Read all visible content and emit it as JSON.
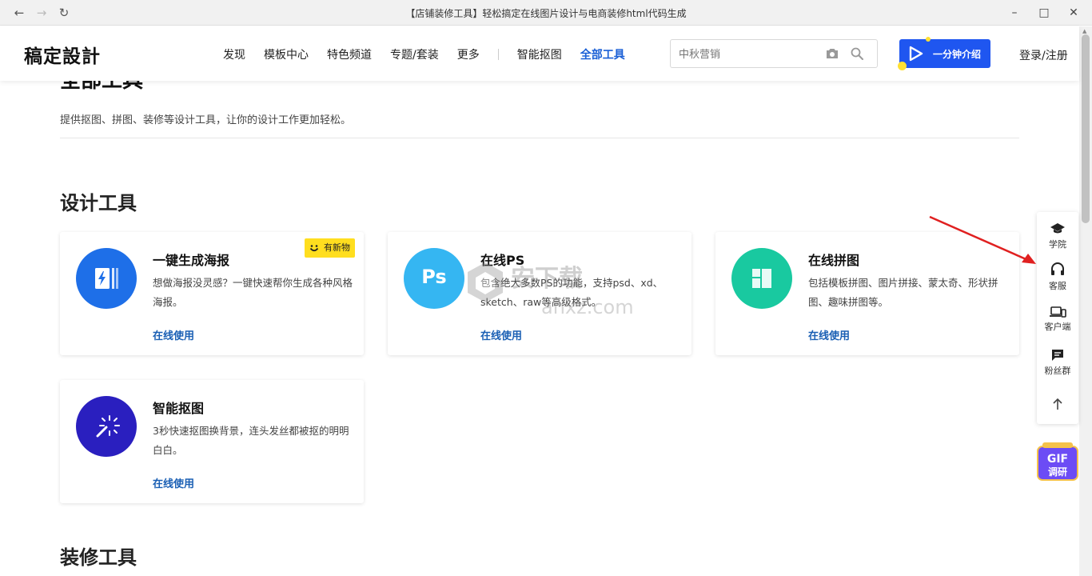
{
  "window": {
    "title": "【店铺装修工具】轻松搞定在线图片设计与电商装修html代码生成"
  },
  "header": {
    "logo": "稿定設計",
    "nav": [
      "发现",
      "模板中心",
      "特色频道",
      "专题/套装",
      "更多",
      "智能抠图",
      "全部工具"
    ],
    "active_nav": "全部工具",
    "search_placeholder": "中秋营销",
    "intro_button": "一分钟介绍",
    "login": "登录/注册"
  },
  "page": {
    "title": "全部工具",
    "description": "提供抠图、拼图、装修等设计工具，让你的设计工作更加轻松。"
  },
  "sections": {
    "design": {
      "title": "设计工具",
      "cards": [
        {
          "name": "一键生成海报",
          "desc": "想做海报没灵感？一键快速帮你生成各种风格海报。",
          "action": "在线使用",
          "badge": "有新物",
          "icon": "poster-icon",
          "color": "#1e6fe8"
        },
        {
          "name": "在线PS",
          "desc": "包含绝大多数PS的功能，支持psd、xd、sketch、raw等高级格式。",
          "action": "在线使用",
          "icon": "ps-icon",
          "icon_text": "Ps",
          "color": "#35b6f2"
        },
        {
          "name": "在线拼图",
          "desc": "包括模板拼图、图片拼接、蒙太奇、形状拼图、趣味拼图等。",
          "action": "在线使用",
          "icon": "collage-icon",
          "color": "#19c9a0"
        },
        {
          "name": "智能抠图",
          "desc": "3秒快速抠图换背景，连头发丝都被抠的明明白白。",
          "action": "在线使用",
          "icon": "magic-wand-icon",
          "color": "#2a1fbf"
        }
      ]
    },
    "decoration": {
      "title": "装修工具"
    }
  },
  "sidebar": {
    "items": [
      "学院",
      "客服",
      "客户端",
      "粉丝群"
    ],
    "gif_badge": "GIF调研"
  },
  "watermark": {
    "text": "安下载",
    "domain": "anxz.com"
  },
  "colors": {
    "accent": "#1f56f0",
    "link": "#1a5fb4",
    "badge": "#ffde1f",
    "annotation_arrow": "#e02020"
  }
}
